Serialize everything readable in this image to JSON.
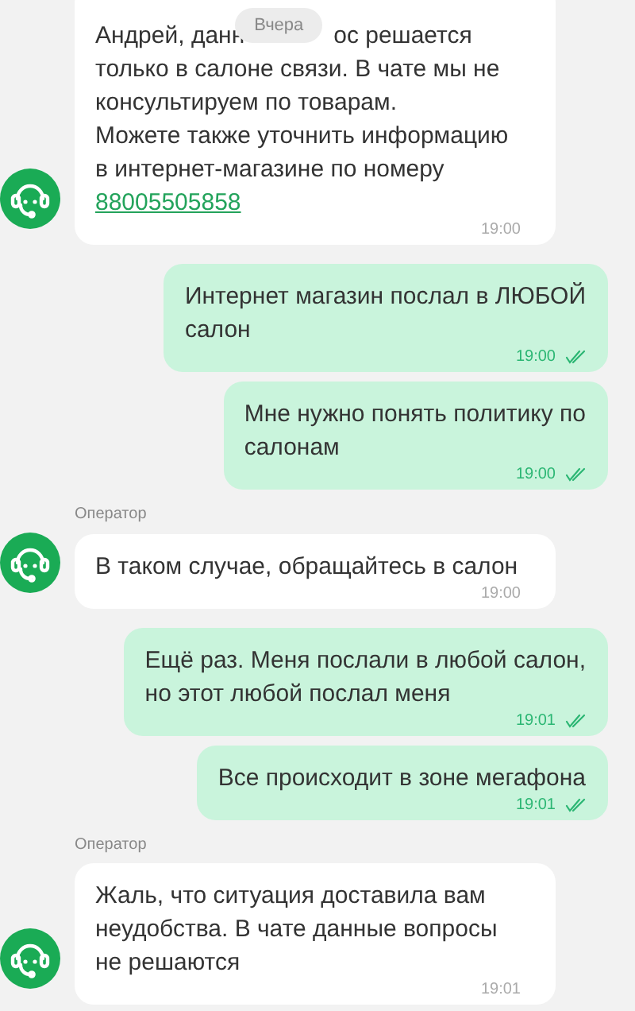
{
  "date_badge": "Вчера",
  "messages": [
    {
      "kind": "incoming",
      "avatar": true,
      "covered_line": {
        "before": "Андрей, данн",
        "after": "ос решается"
      },
      "text": "только в салоне связи. В чате мы не консультируем по товарам.\nМожете также уточнить информацию в интернет-магазине по номеру",
      "link": "88005505858",
      "time": "19:00"
    },
    {
      "kind": "outgoing",
      "text": "Интернет магазин послал в ЛЮБОЙ\nсалон",
      "time": "19:00",
      "read": true
    },
    {
      "kind": "outgoing",
      "text": "Мне нужно понять политику по\nсалонам",
      "time": "19:00",
      "read": true
    },
    {
      "kind": "incoming",
      "avatar": true,
      "sender": "Оператор",
      "text": "В таком случае, обращайтесь в салон",
      "time": "19:00"
    },
    {
      "kind": "outgoing",
      "text": "Ещё раз. Меня послали в любой салон,\nно этот любой послал меня",
      "time": "19:01",
      "read": true
    },
    {
      "kind": "outgoing",
      "text": "Все происходит в зоне мегафона",
      "time": "19:01",
      "read": true
    },
    {
      "kind": "incoming",
      "avatar": true,
      "sender": "Оператор",
      "text": "Жаль, что ситуация доставила вам неудобства. В чате данные вопросы не решаются",
      "time": "19:01"
    }
  ]
}
